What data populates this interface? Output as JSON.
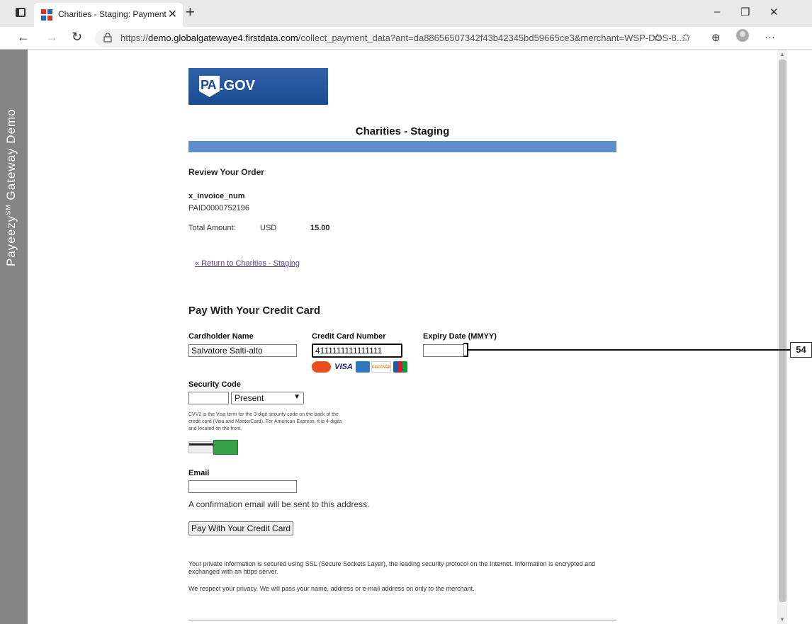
{
  "browser": {
    "tab_title": "Charities - Staging: Payment",
    "tab_close": "✕",
    "new_tab": "+",
    "url_prefix": "https://",
    "url_host": "demo.globalgatewaye4.firstdata.com",
    "url_path": "/collect_payment_data?ant=da88656507342f43b42345bd59665ce3&merchant=WSP-DOS-8...",
    "minimize": "–",
    "restore": "❐",
    "close": "✕",
    "back": "←",
    "forward": "→",
    "reload": "↻",
    "more": "···",
    "icons": {
      "favorites_add": "☆",
      "favorites": "✩",
      "collections": "⊕"
    }
  },
  "rail": {
    "text_before": "Payeezy",
    "superscript": "SM",
    "text_after": " Gateway Demo"
  },
  "page": {
    "logo_pa": "PA",
    "logo_gov": ".GOV",
    "merchant_title": "Charities - Staging",
    "review_heading": "Review Your Order",
    "invoice_label": "x_invoice_num",
    "invoice_value": "PAID0000752196",
    "total_label": "Total Amount:",
    "total_currency": "USD",
    "total_value": "15.00",
    "return_link": "« Return to Charities - Staging",
    "pay_heading": "Pay With Your Credit Card"
  },
  "form": {
    "cardholder_label": "Cardholder Name",
    "cardholder_value": "Salvatore Salti-alto",
    "cc_label": "Credit Card Number",
    "cc_value": "4111111111111111",
    "expiry_label": "Expiry Date (MMYY)",
    "expiry_value": "",
    "security_label": "Security Code",
    "security_value": "",
    "security_select": "Present",
    "cvv_help": "CVV2 is the Visa term for the 3-digit security code on the back of the credit card (Visa and MasterCard). For American Express, it is 4-digits and located on the front.",
    "email_label": "Email",
    "email_value": "",
    "email_note": "A confirmation email will be sent to this address.",
    "submit_label": "Pay With Your Credit Card",
    "card_logos": [
      "MasterCard",
      "VISA",
      "AMEX",
      "DISCOVER",
      "JCB"
    ]
  },
  "footer": {
    "privacy1": "Your private information is secured using SSL (Secure Sockets Layer), the leading security protocol on the Internet. Information is encrypted and exchanged with an https server.",
    "privacy2": "We respect your privacy. We will pass your name, address or e-mail address on only to the merchant."
  },
  "annotation": {
    "label": "54"
  },
  "colors": {
    "accent_bar": "#5f8ccb",
    "logo_blue": "#1c4b8f",
    "rail_gray": "#858585",
    "link_purple": "#5b3b8b"
  }
}
